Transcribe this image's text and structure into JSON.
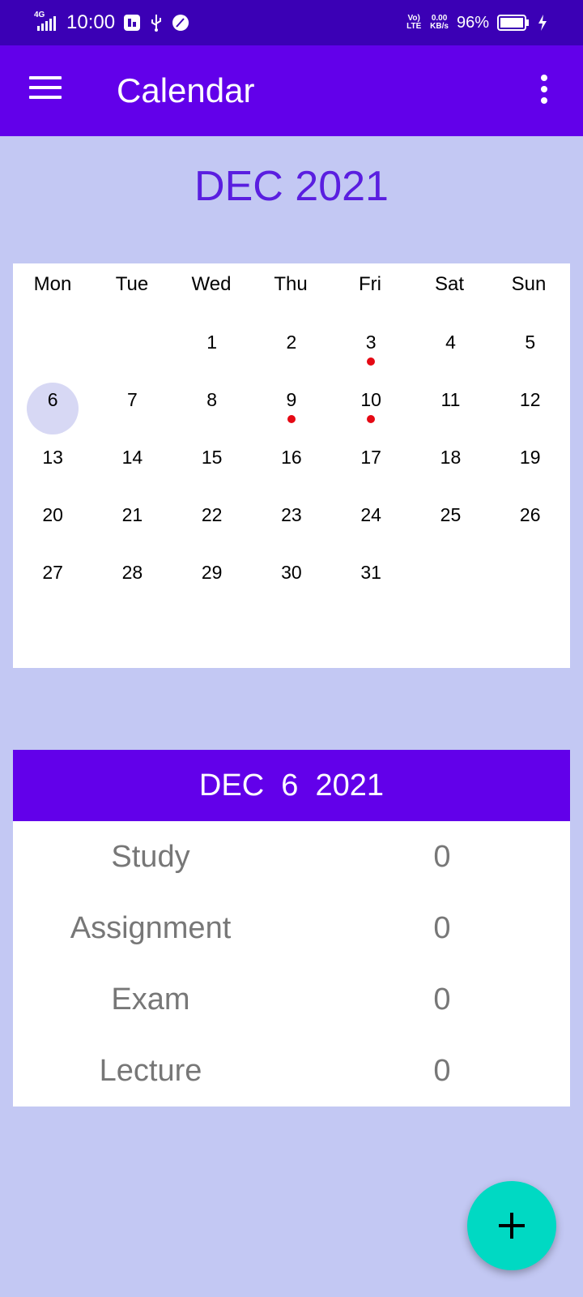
{
  "status_bar": {
    "network": "4G",
    "time": "10:00",
    "volte": "Vo) LTE",
    "speed_value": "0.00",
    "speed_unit": "KB/s",
    "battery": "96%"
  },
  "app_bar": {
    "title": "Calendar",
    "menu_icon": "hamburger-menu-icon",
    "more_icon": "more-vert-icon"
  },
  "calendar": {
    "month_title": "DEC 2021",
    "weekdays": [
      "Mon",
      "Tue",
      "Wed",
      "Thu",
      "Fri",
      "Sat",
      "Sun"
    ],
    "days": [
      "",
      "",
      "1",
      "2",
      "3",
      "4",
      "5",
      "6",
      "7",
      "8",
      "9",
      "10",
      "11",
      "12",
      "13",
      "14",
      "15",
      "16",
      "17",
      "18",
      "19",
      "20",
      "21",
      "22",
      "23",
      "24",
      "25",
      "26",
      "27",
      "28",
      "29",
      "30",
      "31",
      "",
      ""
    ],
    "selected_day": "6",
    "event_days": [
      "3",
      "9",
      "10"
    ],
    "event_dot_color": "#e50914",
    "selected_color": "#d7d8f4"
  },
  "day_summary": {
    "header": "DEC  6  2021",
    "rows": [
      {
        "label": "Study",
        "value": "0"
      },
      {
        "label": "Assignment",
        "value": "0"
      },
      {
        "label": "Exam",
        "value": "0"
      },
      {
        "label": "Lecture",
        "value": "0"
      }
    ]
  },
  "fab": {
    "icon": "plus-icon",
    "color": "#00d9c3"
  },
  "colors": {
    "primary": "#6200ea",
    "status_bar": "#3b00b5",
    "background": "#c3c8f3",
    "accent_text": "#5a1ee0"
  }
}
